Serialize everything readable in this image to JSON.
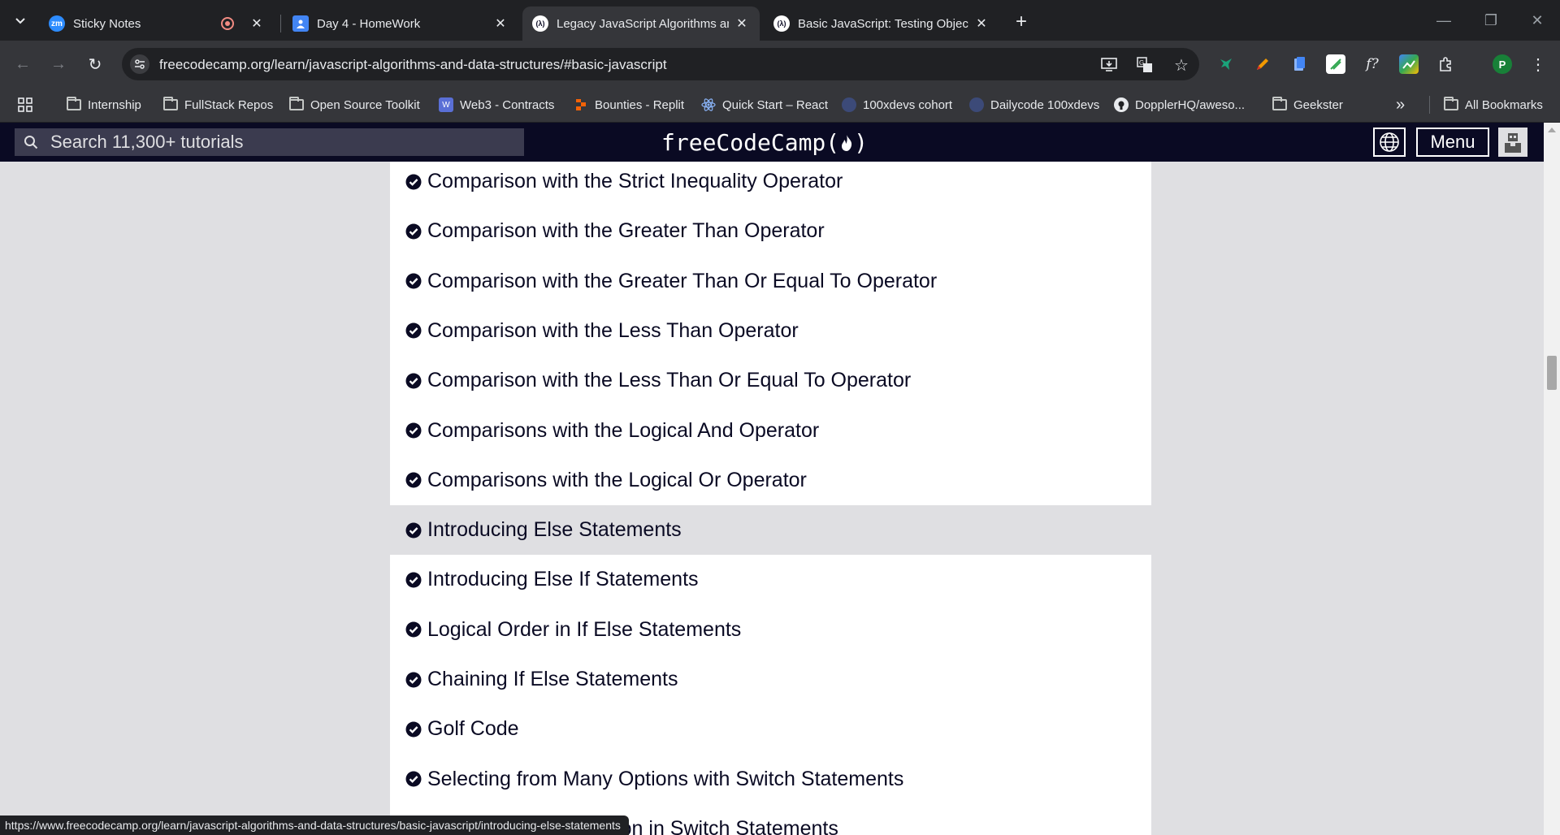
{
  "browser": {
    "tabs": [
      {
        "title": "Sticky Notes",
        "favicon": "zm",
        "active": false,
        "recording": true
      },
      {
        "title": "Day 4 - HomeWork",
        "favicon": "user-doc",
        "active": false
      },
      {
        "title": "Legacy JavaScript Algorithms an",
        "favicon": "(λ)",
        "active": true
      },
      {
        "title": "Basic JavaScript: Testing Object",
        "favicon": "(λ)",
        "active": false
      }
    ],
    "url": "freecodecamp.org/learn/javascript-algorithms-and-data-structures/#basic-javascript",
    "profile_initial": "P",
    "bookmarks": [
      {
        "label": "Internship",
        "icon": "folder-icon"
      },
      {
        "label": "FullStack Repos",
        "icon": "folder-icon"
      },
      {
        "label": "Open Source Toolkit",
        "icon": "folder-icon"
      },
      {
        "label": "Web3 - Contracts",
        "icon": "site-icon"
      },
      {
        "label": "Bounties - Replit",
        "icon": "replit-icon"
      },
      {
        "label": "Quick Start – React",
        "icon": "react-icon"
      },
      {
        "label": "100xdevs cohort",
        "icon": "avatar-icon"
      },
      {
        "label": "Dailycode 100xdevs",
        "icon": "avatar-icon"
      },
      {
        "label": "DopplerHQ/aweso...",
        "icon": "github-icon"
      },
      {
        "label": "Geekster",
        "icon": "folder-icon"
      }
    ],
    "all_bookmarks": "All Bookmarks",
    "more_bookmarks": "»",
    "status_url": "https://www.freecodecamp.org/learn/javascript-algorithms-and-data-structures/basic-javascript/introducing-else-statements"
  },
  "site": {
    "search_placeholder": "Search 11,300+ tutorials",
    "logo": "freeCodeCamp(🔥)",
    "menu_label": "Menu"
  },
  "lessons": [
    {
      "title": "Comparison with the Strict Inequality Operator",
      "completed": true
    },
    {
      "title": "Comparison with the Greater Than Operator",
      "completed": true
    },
    {
      "title": "Comparison with the Greater Than Or Equal To Operator",
      "completed": true
    },
    {
      "title": "Comparison with the Less Than Operator",
      "completed": true
    },
    {
      "title": "Comparison with the Less Than Or Equal To Operator",
      "completed": true
    },
    {
      "title": "Comparisons with the Logical And Operator",
      "completed": true
    },
    {
      "title": "Comparisons with the Logical Or Operator",
      "completed": true
    },
    {
      "title": "Introducing Else Statements",
      "completed": true,
      "hovered": true
    },
    {
      "title": "Introducing Else If Statements",
      "completed": true
    },
    {
      "title": "Logical Order in If Else Statements",
      "completed": true
    },
    {
      "title": "Chaining If Else Statements",
      "completed": true
    },
    {
      "title": "Golf Code",
      "completed": true
    },
    {
      "title": "Selecting from Many Options with Switch Statements",
      "completed": true
    },
    {
      "title": "Adding a Default Option in Switch Statements",
      "completed": true
    }
  ],
  "colors": {
    "fcc_dark": "#0a0a23",
    "fcc_gray": "#dfdfe2",
    "chrome_dark": "#202124",
    "chrome_toolbar": "#35363a"
  }
}
